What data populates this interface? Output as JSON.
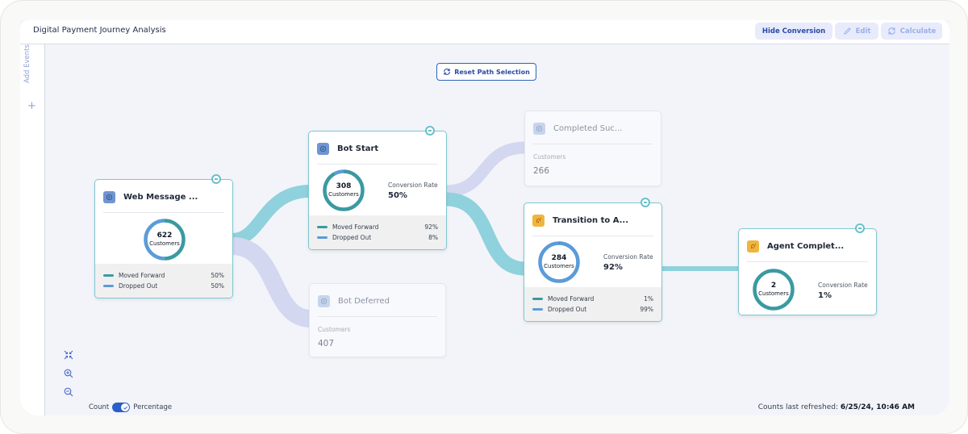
{
  "window": {
    "title": "Digital Payment Journey Analysis"
  },
  "toolbar": {
    "hide_conversion_label": "Hide Conversion",
    "edit_label": "Edit",
    "calculate_label": "Calculate"
  },
  "sidebar": {
    "add_events_label": "Add Events",
    "add_icon": "plus-icon"
  },
  "canvas": {
    "reset_label": "Reset Path Selection",
    "colors": {
      "forward": "#3a9aa1",
      "dropped": "#5b9bd9",
      "link_forward": "#8fd1dc",
      "link_dropped": "#d3d7f0"
    }
  },
  "nodes": {
    "web_message": {
      "name": "Web Message ...",
      "icon": "chat-icon",
      "count": "622",
      "count_label": "Customers",
      "moved_forward_label": "Moved Forward",
      "moved_forward_pct": "50%",
      "moved_forward_value": 0.5,
      "dropped_out_label": "Dropped Out",
      "dropped_out_pct": "50%",
      "dropped_out_value": 0.5
    },
    "bot_start": {
      "name": "Bot Start",
      "icon": "chat-icon",
      "count": "308",
      "count_label": "Customers",
      "conversion_label": "Conversion Rate",
      "conversion_rate": "50%",
      "moved_forward_label": "Moved Forward",
      "moved_forward_pct": "92%",
      "moved_forward_value": 0.92,
      "dropped_out_label": "Dropped Out",
      "dropped_out_pct": "8%",
      "dropped_out_value": 0.08
    },
    "bot_deferred": {
      "name": "Bot Deferred",
      "icon": "chat-icon",
      "label": "Customers",
      "count": "407"
    },
    "completed": {
      "name": "Completed Suc...",
      "icon": "chat-icon",
      "label": "Customers",
      "count": "266"
    },
    "transition": {
      "name": "Transition to A...",
      "icon": "agent-icon",
      "count": "284",
      "count_label": "Customers",
      "conversion_label": "Conversion Rate",
      "conversion_rate": "92%",
      "moved_forward_label": "Moved Forward",
      "moved_forward_pct": "1%",
      "moved_forward_value": 0.01,
      "dropped_out_label": "Dropped Out",
      "dropped_out_pct": "99%",
      "dropped_out_value": 0.99
    },
    "agent_complete": {
      "name": "Agent Complet...",
      "icon": "agent-icon",
      "count": "2",
      "count_label": "Customers",
      "conversion_label": "Conversion Rate",
      "conversion_rate": "1%",
      "moved_forward_value": 1.0,
      "dropped_out_value": 0.0
    }
  },
  "footer": {
    "count_label": "Count",
    "percentage_label": "Percentage",
    "toggle_on": true,
    "refreshed_label": "Counts last refreshed:",
    "refreshed_value": "6/25/24, 10:46 AM"
  }
}
